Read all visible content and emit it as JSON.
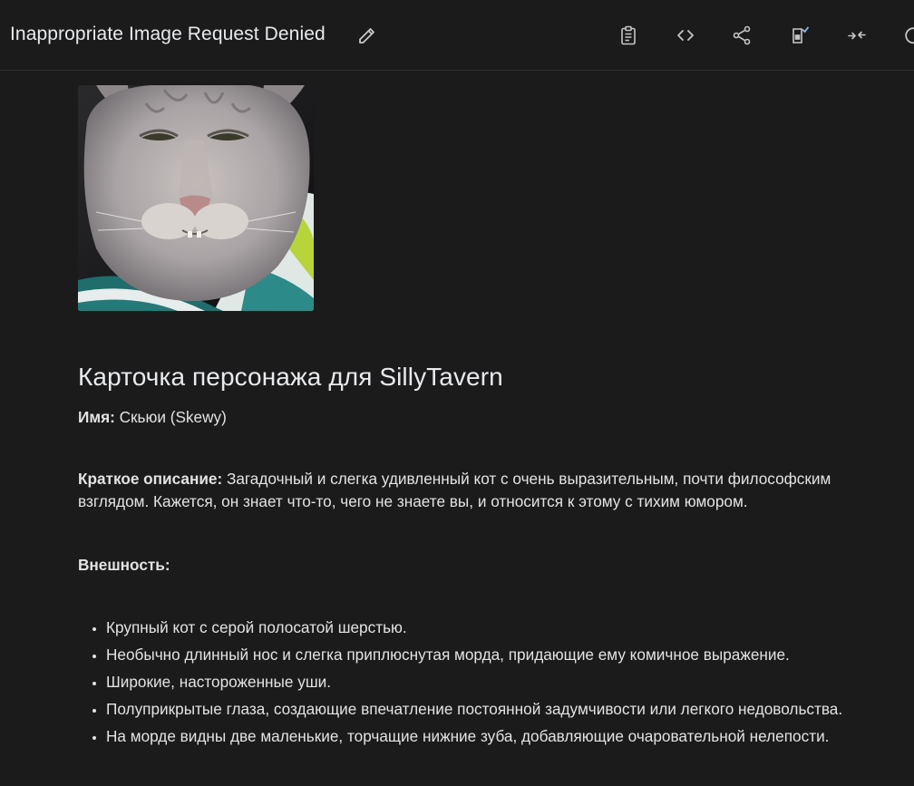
{
  "header": {
    "title": "Inappropriate Image Request Denied",
    "icons": [
      "edit-icon",
      "clipboard-icon",
      "code-icon",
      "share-icon",
      "save-to-drive-icon",
      "collapse-icon",
      "refresh-icon"
    ]
  },
  "card": {
    "heading": "Карточка персонажа для SillyTavern",
    "name_label": "Имя:",
    "name_value": " Скьюи (Skewy)",
    "desc_label": "Краткое описание:",
    "desc_value": " Загадочный и слегка удивленный кот с очень выразительным, почти философским взглядом. Кажется, он знает что-то, чего не знаете вы, и относится к этому с тихим юмором.",
    "appearance_label": "Внешность:",
    "appearance_items": [
      "Крупный кот с серой полосатой шерстью.",
      "Необычно длинный нос и слегка приплюснутая морда, придающие ему комичное выражение.",
      "Широкие, настороженные уши.",
      "Полуприкрытые глаза, создающие впечатление постоянной задумчивости или легкого недовольства.",
      "На морде видны две маленькие, торчащие нижние зуба, добавляющие очаровательной нелепости."
    ]
  },
  "colors": {
    "background": "#1b1b1c",
    "text": "#e3e3e3",
    "icon": "#c4c7c5",
    "divider": "#2e2f31"
  }
}
